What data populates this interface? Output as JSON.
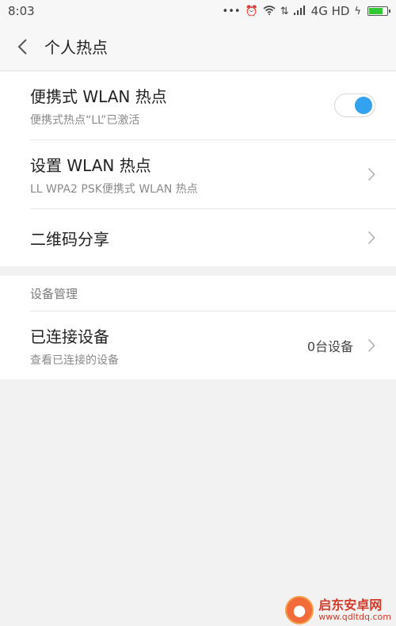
{
  "status_bar": {
    "time": "8:03",
    "indicators": [
      "more-dots-icon",
      "alarm-icon",
      "wifi-icon",
      "data-arrows-icon",
      "signal-icon"
    ],
    "network": "4G HD",
    "charging": true
  },
  "header": {
    "title": "个人热点"
  },
  "hotspot": {
    "portable_wlan": {
      "label": "便携式 WLAN 热点",
      "sub": "便携式热点“LL”已激活",
      "enabled": true
    },
    "setup": {
      "label": "设置 WLAN 热点",
      "sub": "LL WPA2 PSK便携式 WLAN 热点"
    },
    "qr_share": {
      "label": "二维码分享"
    }
  },
  "device_management": {
    "section_label": "设备管理",
    "connected": {
      "label": "已连接设备",
      "sub": "查看已连接的设备",
      "value": "0台设备"
    }
  },
  "watermark": {
    "title": "启东安卓网",
    "url": "www.qdltdq.com"
  },
  "colors": {
    "accent": "#33a3f0",
    "background": "#f2f2f2",
    "watermark": "#d23a2a"
  }
}
